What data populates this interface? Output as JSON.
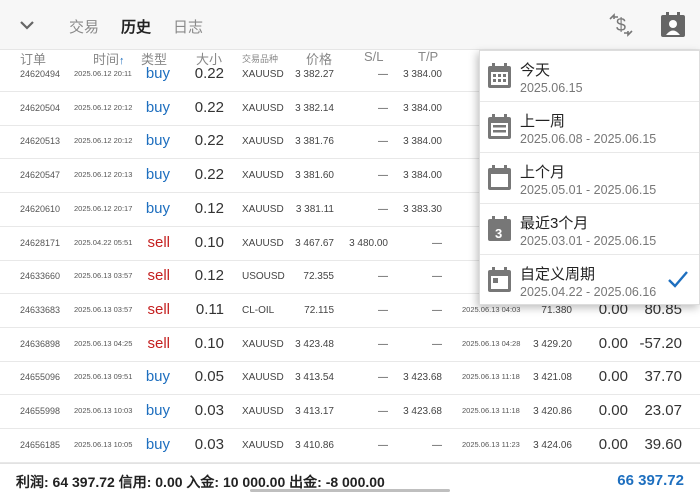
{
  "topbar": {
    "tabs": [
      {
        "label": "交易",
        "active": false
      },
      {
        "label": "历史",
        "active": true
      },
      {
        "label": "日志",
        "active": false
      }
    ],
    "icons": [
      "chevron-down-icon",
      "dollar-sort-icon",
      "calendar-user-icon"
    ]
  },
  "header": {
    "order": "订单",
    "time": "时间",
    "type": "类型",
    "size": "大小",
    "symbol": "交易品种",
    "price": "价格",
    "sl": "S/L",
    "tp": "T/P"
  },
  "rows": [
    {
      "id": "24620494",
      "time": "2025.06.12 20:11",
      "type": "buy",
      "size": "0.22",
      "symbol": "XAUUSD",
      "price": "3 382.27",
      "sl": "—",
      "tp": "3 384.00",
      "close_time": "",
      "close_price": "",
      "swap": "",
      "profit": ""
    },
    {
      "id": "24620504",
      "time": "2025.06.12 20:12",
      "type": "buy",
      "size": "0.22",
      "symbol": "XAUUSD",
      "price": "3 382.14",
      "sl": "—",
      "tp": "3 384.00",
      "close_time": "",
      "close_price": "",
      "swap": "",
      "profit": ""
    },
    {
      "id": "24620513",
      "time": "2025.06.12 20:12",
      "type": "buy",
      "size": "0.22",
      "symbol": "XAUUSD",
      "price": "3 381.76",
      "sl": "—",
      "tp": "3 384.00",
      "close_time": "",
      "close_price": "",
      "swap": "",
      "profit": ""
    },
    {
      "id": "24620547",
      "time": "2025.06.12 20:13",
      "type": "buy",
      "size": "0.22",
      "symbol": "XAUUSD",
      "price": "3 381.60",
      "sl": "—",
      "tp": "3 384.00",
      "close_time": "",
      "close_price": "",
      "swap": "",
      "profit": ""
    },
    {
      "id": "24620610",
      "time": "2025.06.12 20:17",
      "type": "buy",
      "size": "0.12",
      "symbol": "XAUUSD",
      "price": "3 381.11",
      "sl": "—",
      "tp": "3 383.30",
      "close_time": "",
      "close_price": "",
      "swap": "",
      "profit": ""
    },
    {
      "id": "24628171",
      "time": "2025.04.22 05:51",
      "type": "sell",
      "size": "0.10",
      "symbol": "XAUUSD",
      "price": "3 467.67",
      "sl": "3 480.00",
      "tp": "—",
      "close_time": "",
      "close_price": "",
      "swap": "",
      "profit": ""
    },
    {
      "id": "24633660",
      "time": "2025.06.13 03:57",
      "type": "sell",
      "size": "0.12",
      "symbol": "USOUSD",
      "price": "72.355",
      "sl": "—",
      "tp": "—",
      "close_time": "",
      "close_price": "",
      "swap": "",
      "profit": ""
    },
    {
      "id": "24633683",
      "time": "2025.06.13 03:57",
      "type": "sell",
      "size": "0.11",
      "symbol": "CL-OIL",
      "price": "72.115",
      "sl": "—",
      "tp": "—",
      "close_time": "2025.06.13 04:03",
      "close_price": "71.380",
      "swap": "0.00",
      "profit": "80.85"
    },
    {
      "id": "24636898",
      "time": "2025.06.13 04:25",
      "type": "sell",
      "size": "0.10",
      "symbol": "XAUUSD",
      "price": "3 423.48",
      "sl": "—",
      "tp": "—",
      "close_time": "2025.06.13 04:28",
      "close_price": "3 429.20",
      "swap": "0.00",
      "profit": "-57.20"
    },
    {
      "id": "24655096",
      "time": "2025.06.13 09:51",
      "type": "buy",
      "size": "0.05",
      "symbol": "XAUUSD",
      "price": "3 413.54",
      "sl": "—",
      "tp": "3 423.68",
      "close_time": "2025.06.13 11:18",
      "close_price": "3 421.08",
      "swap": "0.00",
      "profit": "37.70"
    },
    {
      "id": "24655998",
      "time": "2025.06.13 10:03",
      "type": "buy",
      "size": "0.03",
      "symbol": "XAUUSD",
      "price": "3 413.17",
      "sl": "—",
      "tp": "3 423.68",
      "close_time": "2025.06.13 11:18",
      "close_price": "3 420.86",
      "swap": "0.00",
      "profit": "23.07"
    },
    {
      "id": "24656185",
      "time": "2025.06.13 10:05",
      "type": "buy",
      "size": "0.03",
      "symbol": "XAUUSD",
      "price": "3 410.86",
      "sl": "—",
      "tp": "—",
      "close_time": "2025.06.13 11:23",
      "close_price": "3 424.06",
      "swap": "0.00",
      "profit": "39.60"
    }
  ],
  "footer": {
    "summary": "利润: 64 397.72  信用: 0.00  入金: 10 000.00  出金: -8 000.00",
    "total": "66 397.72"
  },
  "dropdown": {
    "items": [
      {
        "title": "今天",
        "range": "2025.06.15",
        "icon": "calendar-grid-icon",
        "checked": false
      },
      {
        "title": "上一周",
        "range": "2025.06.08 - 2025.06.15",
        "icon": "calendar-lines-icon",
        "checked": false
      },
      {
        "title": "上个月",
        "range": "2025.05.01 - 2025.06.15",
        "icon": "calendar-month-icon",
        "checked": false
      },
      {
        "title": "最近3个月",
        "range": "2025.03.01 - 2025.06.15",
        "icon": "calendar-three-icon",
        "checked": false
      },
      {
        "title": "自定义周期",
        "range": "2025.04.22 - 2025.06.16",
        "icon": "calendar-custom-icon",
        "checked": true
      }
    ]
  },
  "colors": {
    "buy": "#1e6fbf",
    "sell": "#c41f1f",
    "accent": "#1e6fbf"
  }
}
